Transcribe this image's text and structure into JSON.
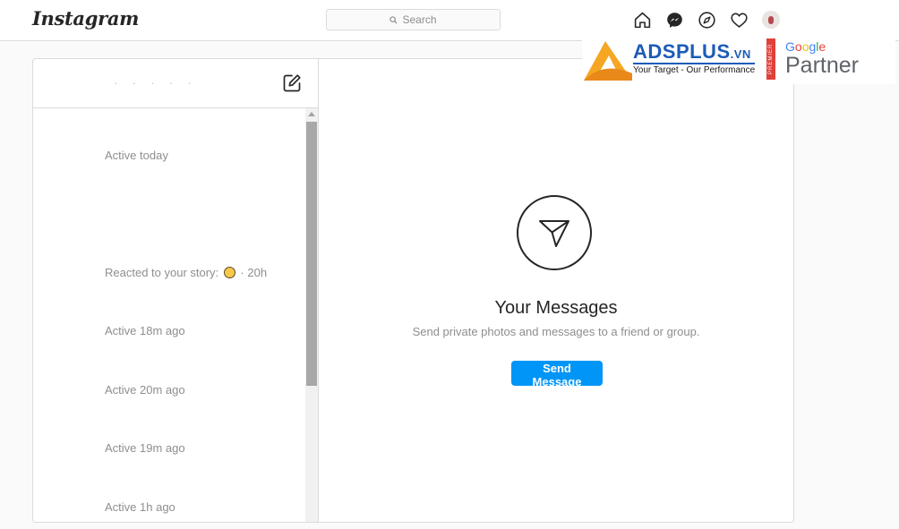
{
  "header": {
    "logo": "Instagram",
    "search_placeholder": "Search",
    "nav_icons": [
      "home-icon",
      "messenger-icon",
      "explore-icon",
      "heart-icon",
      "profile-avatar"
    ]
  },
  "inbox": {
    "account_name": "· · · · ·",
    "threads": [
      {
        "status": "Active today"
      },
      {
        "status": ""
      },
      {
        "status_prefix": "Reacted to your story:",
        "status_suffix": "· 20h"
      },
      {
        "status": "Active 18m ago"
      },
      {
        "status": "Active 20m ago"
      },
      {
        "status": "Active 19m ago"
      },
      {
        "status": "Active 1h ago"
      }
    ]
  },
  "main": {
    "title": "Your Messages",
    "subtitle": "Send private photos and messages to a friend or group.",
    "button": "Send Message"
  },
  "ad": {
    "brand": "ADSPLUS",
    "tld": ".VN",
    "tagline": "Your Target - Our Performance",
    "premier": "PREMIER",
    "google_letters": [
      "G",
      "o",
      "o",
      "g",
      "l",
      "e"
    ],
    "partner": "Partner"
  },
  "colors": {
    "accent": "#0095f6",
    "border": "#dbdbdb",
    "muted_text": "#8e8e8e",
    "ad_blue": "#1c5bb8",
    "ad_orange": "#f5a623",
    "premier_red": "#e0403a"
  }
}
